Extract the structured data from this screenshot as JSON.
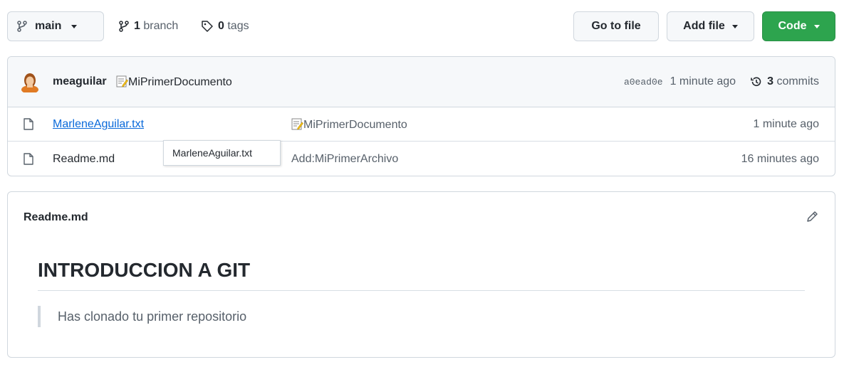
{
  "toolbar": {
    "branch_label": "main",
    "branch_count": "1",
    "branch_text": "branch",
    "tag_count": "0",
    "tag_text": "tags",
    "goto_label": "Go to file",
    "addfile_label": "Add file",
    "code_label": "Code"
  },
  "commit": {
    "author": "meaguilar",
    "message": "MiPrimerDocumento",
    "sha": "a0ead0e",
    "time": "1 minute ago",
    "commits_count": "3",
    "commits_text": "commits"
  },
  "files": [
    {
      "name": "MarleneAguilar.txt",
      "message": "MiPrimerDocumento",
      "time": "1 minute ago"
    },
    {
      "name": "Readme.md",
      "message": "Add:MiPrimerArchivo",
      "time": "16 minutes ago"
    }
  ],
  "tooltip": {
    "text": "MarleneAguilar.txt"
  },
  "readme": {
    "filename": "Readme.md",
    "heading": "INTRODUCCION A GIT",
    "quote": "Has clonado tu primer repositorio"
  },
  "colors": {
    "accent_green": "#2da44e",
    "link_blue": "#0969da"
  },
  "icons": [
    "git-branch-icon",
    "tag-icon",
    "history-icon",
    "file-icon",
    "pencil-icon",
    "memo-icon"
  ]
}
